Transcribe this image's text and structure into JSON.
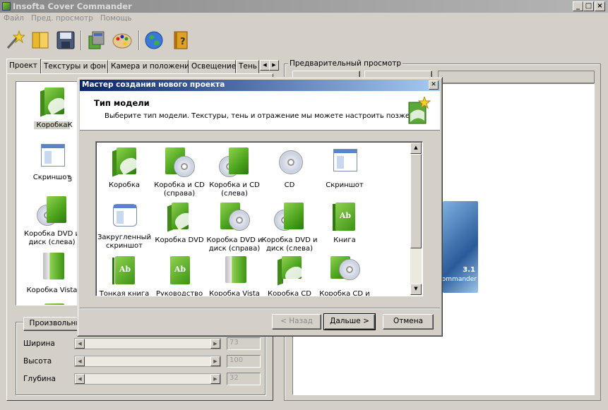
{
  "window": {
    "title": "Insofta Cover Commander",
    "min": "_",
    "max": "□",
    "close": "×"
  },
  "menu": [
    "Файл",
    "Пред. просмотр",
    "Помощь"
  ],
  "toolbar": [
    "new-project-icon",
    "open-folder-icon",
    "save-disk-icon",
    "render-icon",
    "palette-icon",
    "globe-icon",
    "help-book-icon"
  ],
  "tabs": [
    "Проект",
    "Текстуры и фон",
    "Камера и положение",
    "Освещение",
    "Тень"
  ],
  "tab_arrows": [
    "◀",
    "▶"
  ],
  "left_list": [
    {
      "label": "Коробка",
      "icon": "box"
    },
    {
      "label": "Скриншот",
      "icon": "screenshot"
    },
    {
      "label": "Коробка DVD и диск (слева)",
      "icon": "box-dvd"
    },
    {
      "label": "Коробка Vista",
      "icon": "vista"
    }
  ],
  "left_partial": [
    "К",
    "З"
  ],
  "size_group": {
    "button": "Произвольный",
    "rows": [
      {
        "label": "Ширина",
        "value": "73"
      },
      {
        "label": "Высота",
        "value": "100"
      },
      {
        "label": "Глубина",
        "value": "32"
      }
    ]
  },
  "preview": {
    "label": "Предварительный просмотр",
    "version": "3.1",
    "brand": "ommander"
  },
  "dialog": {
    "title": "Мастер создания нового проекта",
    "header_title": "Тип модели",
    "header_subtitle": "Выберите тип модели. Текстуры, тень и отражение мы можете настроить позже",
    "items": [
      {
        "label": "Коробка",
        "icon": "box"
      },
      {
        "label": "Коробка и CD (справа)",
        "icon": "box-cd"
      },
      {
        "label": "Коробка и CD (слева)",
        "icon": "box-cd"
      },
      {
        "label": "CD",
        "icon": "cd"
      },
      {
        "label": "Скриншот",
        "icon": "screenshot"
      },
      {
        "label": "Закругленный скриншот",
        "icon": "screenshot"
      },
      {
        "label": "Коробка DVD",
        "icon": "box"
      },
      {
        "label": "Коробка DVD и диск (справа)",
        "icon": "box-cd"
      },
      {
        "label": "Коробка DVD и диск (слева)",
        "icon": "box-cd"
      },
      {
        "label": "Книга",
        "icon": "book"
      },
      {
        "label": "Тонкая книга",
        "icon": "book"
      },
      {
        "label": "Руководство",
        "icon": "book"
      },
      {
        "label": "Коробка Vista",
        "icon": "vista"
      },
      {
        "label": "Коробка CD",
        "icon": "box"
      },
      {
        "label": "Коробка CD и",
        "icon": "box-cd"
      }
    ],
    "back": "< Назад",
    "next": "Дальше >",
    "cancel": "Отмена"
  }
}
